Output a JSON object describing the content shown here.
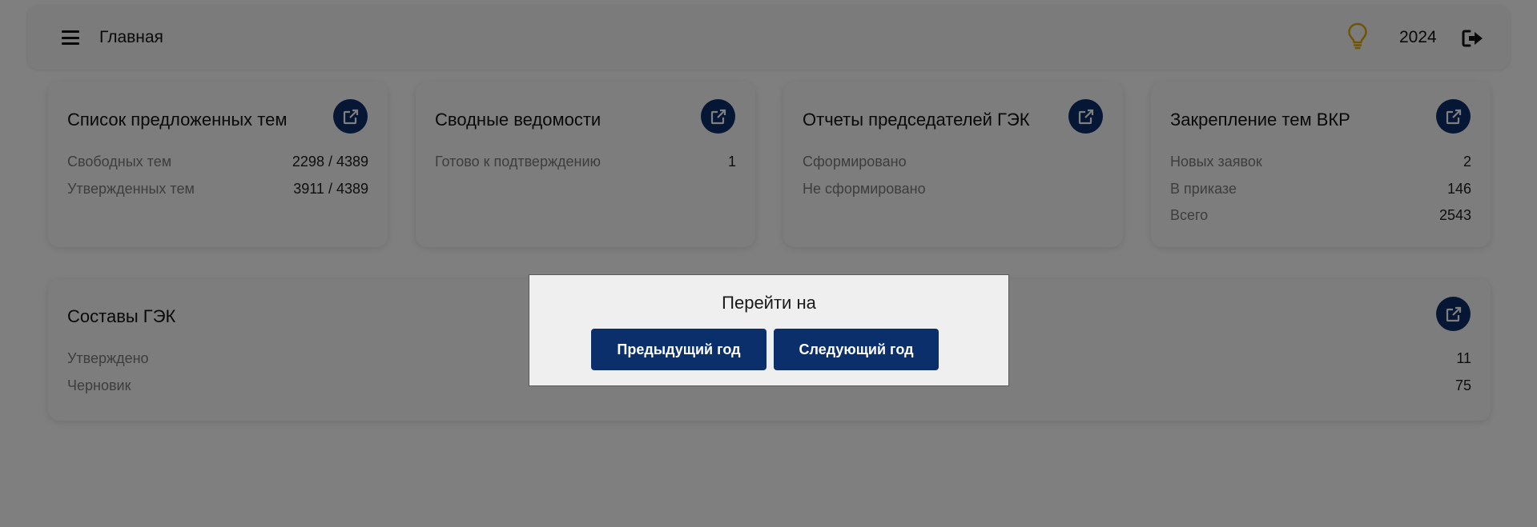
{
  "header": {
    "menu_icon": "hamburger-menu-icon",
    "title": "Главная",
    "hint_icon": "lightbulb-icon",
    "year": "2024",
    "logout_icon": "logout-icon"
  },
  "cards": [
    {
      "title": "Список предложенных тем",
      "open_icon": "external-link-icon",
      "rows": [
        {
          "label": "Свободных тем",
          "value": "2298 / 4389"
        },
        {
          "label": "Утвержденных тем",
          "value": "3911 / 4389"
        }
      ]
    },
    {
      "title": "Сводные ведомости",
      "open_icon": "external-link-icon",
      "rows": [
        {
          "label": "Готово к подтверждению",
          "value": "1"
        }
      ]
    },
    {
      "title": "Отчеты председателей ГЭК",
      "open_icon": "external-link-icon",
      "rows": [
        {
          "label": "Сформировано",
          "value": ""
        },
        {
          "label": "Не сформировано",
          "value": ""
        }
      ]
    },
    {
      "title": "Закрепление тем ВКР",
      "open_icon": "external-link-icon",
      "rows": [
        {
          "label": "Новых заявок",
          "value": "2"
        },
        {
          "label": "В приказе",
          "value": "146"
        },
        {
          "label": "Всего",
          "value": "2543"
        }
      ]
    },
    {
      "title": "Составы ГЭК",
      "open_icon": "external-link-icon",
      "rows": [
        {
          "label": "Утверждено",
          "value": "11"
        },
        {
          "label": "Черновик",
          "value": "75"
        }
      ]
    }
  ],
  "dialog": {
    "title": "Перейти на",
    "prev_label": "Предыдущий год",
    "next_label": "Следующий год"
  },
  "colors": {
    "accent": "#0a2f6b",
    "bulb": "#e0a800",
    "overlay": "rgba(0,0,0,0.5)"
  }
}
